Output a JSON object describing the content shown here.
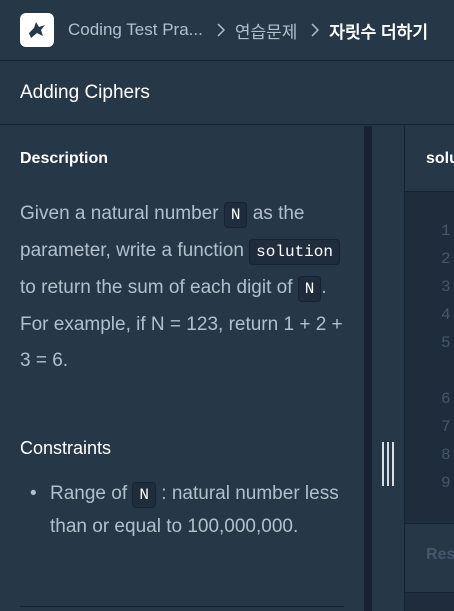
{
  "breadcrumb": {
    "items": [
      "Coding Test Pra...",
      "연습문제"
    ],
    "current": "자릿수 더하기"
  },
  "problem": {
    "title": "Adding Ciphers",
    "description_heading": "Description",
    "desc": {
      "t1": "Given a natural number ",
      "c1": "N",
      "t2": " as the parameter, write a function ",
      "c2": "solution",
      "t3": " to return the sum of each digit of ",
      "c3": "N",
      "t4": ".",
      "example": "For example, if N = 123, return 1 + 2 + 3 = 6."
    },
    "constraints_heading": "Constraints",
    "constraint": {
      "t1": "Range of ",
      "c1": "N",
      "t2": " : natural number less than or equal to 100,000,000."
    }
  },
  "editor": {
    "header": "solution.py",
    "line_numbers": [
      "1",
      "2",
      "3",
      "4",
      "5",
      "",
      "6",
      "7",
      "8",
      "9"
    ],
    "result_label": "Result"
  },
  "icons": {
    "logo": "bird-logo-icon",
    "separator": "chevron-right-icon",
    "splitter": "drag-handle-icon"
  },
  "colors": {
    "background": "#263747",
    "panel_dark": "#1e2c3c",
    "border": "#172334",
    "text": "#b2c0cc",
    "white": "#ffffff"
  }
}
